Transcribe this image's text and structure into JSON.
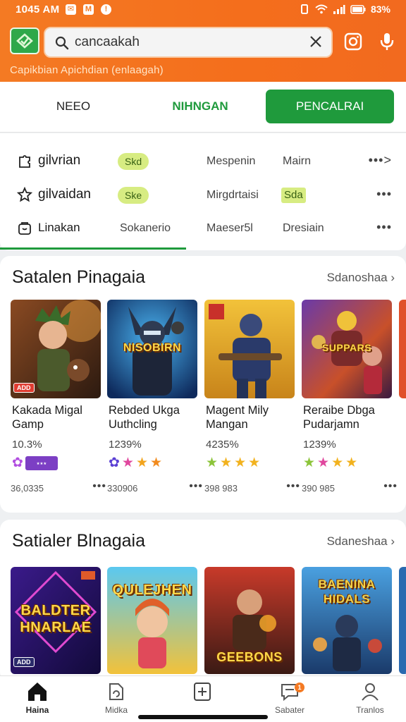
{
  "status_bar": {
    "time": "1045 AM",
    "battery": "83%"
  },
  "search": {
    "value": "cancaakah"
  },
  "header": {
    "subtitle": "Capikbian Apichdian (enlaagah)"
  },
  "tabs": [
    {
      "label": "NEEO"
    },
    {
      "label": "NIHNGAN"
    },
    {
      "label": "PENCALRAI"
    }
  ],
  "categories": [
    {
      "title": "gilvrian",
      "pill": "Skd",
      "col2": "Mespenin",
      "col3": "Mairn"
    },
    {
      "title": "gilvaidan",
      "pill": "Ske",
      "col2": "Mirgdrtaisi",
      "col3": "Sda"
    },
    {
      "title": "Linakan",
      "col1": "Sokanerio",
      "col2": "Maeser5l",
      "col3": "Dresiain"
    }
  ],
  "section1": {
    "title": "Satalen Pinagaia",
    "see_all": "Sdanoshaa",
    "games": [
      {
        "title": "Kakada Migal Gamp",
        "rating": "10.3%",
        "downloads": "36,0335",
        "badge": "ADD",
        "icon": "hero-boy-art",
        "stars": [
          "purple-flower",
          "purple-badge"
        ]
      },
      {
        "title": "Rebded Ukga Uuthcling",
        "rating": "1239%",
        "downloads": "330906",
        "icon": "ninja-warrior-art",
        "banner": "NISOBIRN",
        "stars": [
          "purple-flower",
          "pink-star",
          "gold-star",
          "gold-star"
        ]
      },
      {
        "title": "Magent Mily Mangan",
        "rating": "4235%",
        "downloads": "398 983",
        "icon": "armored-soldier-art",
        "stars": [
          "green-star",
          "gold-star",
          "gold-star",
          "gold-star"
        ]
      },
      {
        "title": "Reraibe Dbga Pudarjamn",
        "rating": "1239%",
        "downloads": "390 985",
        "icon": "adventure-heroes-art",
        "banner": "SUPPARS",
        "stars": [
          "green-star",
          "pink-star",
          "gold-star",
          "gold-star"
        ]
      }
    ]
  },
  "section2": {
    "title": "Satialer Blnagaia",
    "see_all": "Sdaneshaa",
    "games": [
      {
        "banner": "BALDTER HNARLAE",
        "badge": "ADD",
        "icon": "neon-logo-art"
      },
      {
        "banner": "QULEJHEN",
        "icon": "cartoon-girl-art"
      },
      {
        "banner": "GEEBONS",
        "icon": "fire-warrior-art"
      },
      {
        "banner": "BAENINA HIDALS",
        "icon": "battle-squad-art"
      }
    ]
  },
  "bottom_nav": [
    {
      "label": "Haina",
      "icon": "home-icon"
    },
    {
      "label": "Midka",
      "icon": "refresh-doc-icon"
    },
    {
      "label": "",
      "icon": "add-box-icon"
    },
    {
      "label": "Sabater",
      "icon": "chat-icon",
      "badge": "1"
    },
    {
      "label": "Tranlos",
      "icon": "profile-icon"
    }
  ],
  "colors": {
    "header": "#f47a23",
    "accent_green": "#1f9a3c",
    "pill": "#d7ec82"
  }
}
